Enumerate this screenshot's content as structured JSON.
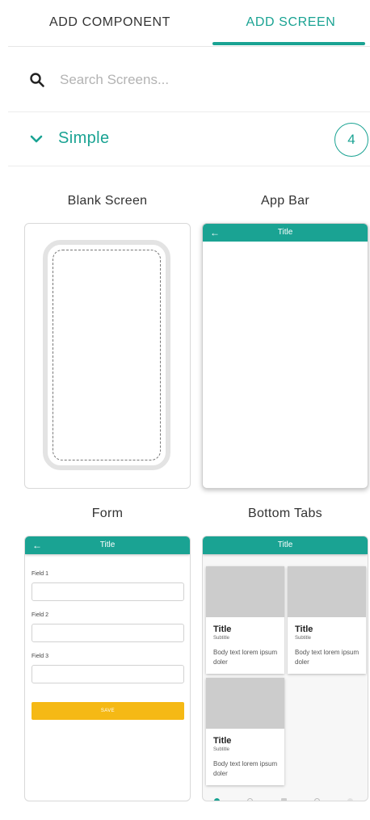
{
  "tabs": [
    {
      "label": "ADD COMPONENT",
      "active": false
    },
    {
      "label": "ADD SCREEN",
      "active": true
    }
  ],
  "search": {
    "placeholder": "Search Screens...",
    "value": "",
    "icon": "search-icon"
  },
  "section": {
    "label": "Simple",
    "count": "4",
    "icon": "chevron-down-icon",
    "expanded": true
  },
  "colors": {
    "accent": "#1aa393",
    "save_button": "#f5b915",
    "placeholder_gray": "#cccccc"
  },
  "templates": [
    {
      "label": "Blank Screen"
    },
    {
      "label": "App Bar",
      "app_bar_title": "Title",
      "back_icon": "←"
    },
    {
      "label": "Form",
      "app_bar_title": "Title",
      "back_icon": "←",
      "fields": [
        {
          "label": "Field 1",
          "value": ""
        },
        {
          "label": "Field 2",
          "value": ""
        },
        {
          "label": "Field 3",
          "value": ""
        }
      ],
      "save_label": "SAVE"
    },
    {
      "label": "Bottom Tabs",
      "app_bar_title": "Title",
      "cards": [
        {
          "title": "Title",
          "subtitle": "Subtitle",
          "body": "Body text lorem ipsum doler"
        },
        {
          "title": "Title",
          "subtitle": "Subtitle",
          "body": "Body text lorem ipsum doler"
        },
        {
          "title": "Title",
          "subtitle": "Subtitle",
          "body": "Body text lorem ipsum doler"
        }
      ]
    }
  ]
}
